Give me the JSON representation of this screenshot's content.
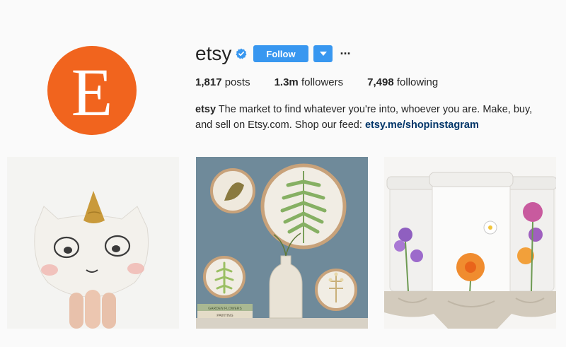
{
  "profile": {
    "avatar_letter": "E",
    "avatar_color": "#f1641e",
    "username": "etsy",
    "verified_icon": "verified-badge-icon",
    "follow_label": "Follow",
    "more_label": "···"
  },
  "stats": {
    "posts_count": "1,817",
    "posts_label": "posts",
    "followers_count": "1.3m",
    "followers_label": "followers",
    "following_count": "7,498",
    "following_label": "following"
  },
  "bio": {
    "name": "etsy",
    "text": "The market to find whatever you're into, whoever you are. Make, buy, and sell on Etsy.com. Shop our feed: ",
    "link": "etsy.me/shopinstagram"
  },
  "posts": [
    {
      "subject": "ceramic-unicorn-cat-bowl"
    },
    {
      "subject": "embroidery-hoops-with-pressed-plants"
    },
    {
      "subject": "floral-painted-travel-cups"
    }
  ],
  "book_labels": {
    "book1": "GARDEN FLOWERS",
    "book2": "PAINTING"
  },
  "colors": {
    "accent": "#3897f0",
    "link": "#003569",
    "background": "#fafafa"
  }
}
